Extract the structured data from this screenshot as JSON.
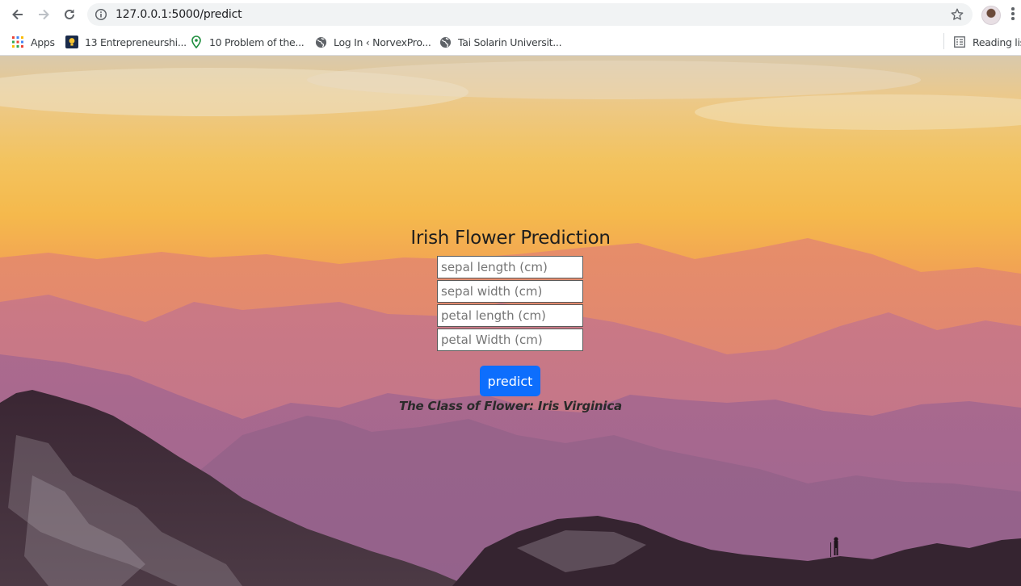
{
  "browser": {
    "url": "127.0.0.1:5000/predict",
    "bookmarks": [
      {
        "label": "Apps",
        "icon": "apps-grid-icon"
      },
      {
        "label": "13 Entrepreneurshi...",
        "icon": "lightbulb-icon"
      },
      {
        "label": "10 Problem of the...",
        "icon": "map-pin-icon"
      },
      {
        "label": "Log In ‹ NorvexPro...",
        "icon": "globe-icon"
      },
      {
        "label": "Tai Solarin Universit...",
        "icon": "globe-icon"
      }
    ],
    "reading_list": "Reading list"
  },
  "page": {
    "title": "Irish Flower Prediction",
    "fields": [
      {
        "placeholder": "sepal length (cm)",
        "value": ""
      },
      {
        "placeholder": "sepal width (cm)",
        "value": ""
      },
      {
        "placeholder": "petal length (cm)",
        "value": ""
      },
      {
        "placeholder": "petal Width (cm)",
        "value": ""
      }
    ],
    "button_label": "predict",
    "result": "The Class of Flower: Iris Virginica"
  },
  "colors": {
    "button": "#0d6efd",
    "sky_top": "#d9c9ac",
    "sky_mid": "#f3c35e",
    "haze": "#c8788c"
  }
}
